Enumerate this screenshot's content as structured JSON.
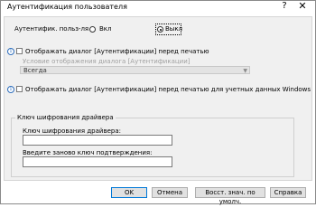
{
  "window": {
    "title": "Аутентификация пользователя",
    "help": "?",
    "close": "✕"
  },
  "auth": {
    "label": "Аутентифик. польз-ля",
    "option_on": "Вкл",
    "option_off": "Выкл",
    "selected": "Выкл"
  },
  "options": {
    "show_dialog_label": "Отображать диалог [Аутентификации] перед печатью",
    "show_dialog_checked": false,
    "condition_label": "Условие отображения диалога [Аутентификации]",
    "condition_value": "Всегда",
    "show_dialog_windows_label": "Отображать диалог [Аутентификации] перед печатью для учетных данных Windows",
    "show_dialog_windows_checked": false
  },
  "driver_key": {
    "group_label": "Ключ шифрования драйвера",
    "key_label": "Ключ шифрования драйвера:",
    "key_value": "",
    "confirm_label": "Введите заново ключ подтверждения:",
    "confirm_value": ""
  },
  "buttons": {
    "ok": "OK",
    "cancel": "Отмена",
    "restore": "Восст. знач. по умолч.",
    "help": "Справка"
  }
}
